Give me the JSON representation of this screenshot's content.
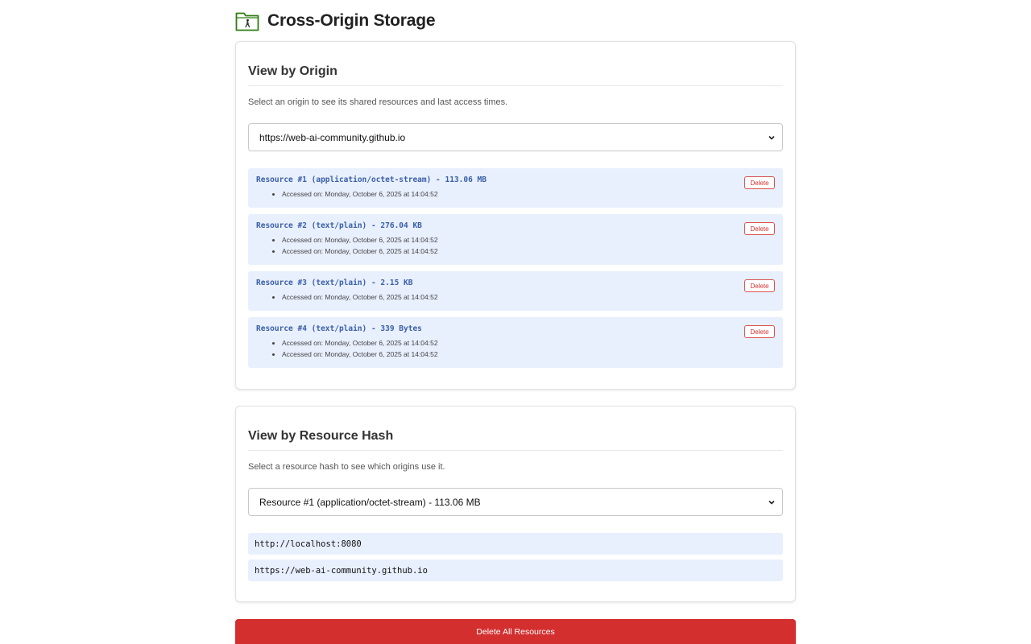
{
  "header": {
    "title": "Cross-Origin Storage",
    "icon": "folder-person-icon",
    "icon_color": "#2e7d12"
  },
  "by_origin": {
    "heading": "View by Origin",
    "description": "Select an origin to see its shared resources and last access times.",
    "selected_origin": "https://web-ai-community.github.io",
    "delete_label": "Delete",
    "resources": [
      {
        "title": "Resource #1 (application/octet-stream) - 113.06 MB",
        "accesses": [
          "Accessed on: Monday, October 6, 2025 at 14:04:52"
        ]
      },
      {
        "title": "Resource #2 (text/plain) - 276.04 KB",
        "accesses": [
          "Accessed on: Monday, October 6, 2025 at 14:04:52",
          "Accessed on: Monday, October 6, 2025 at 14:04:52"
        ]
      },
      {
        "title": "Resource #3 (text/plain) - 2.15 KB",
        "accesses": [
          "Accessed on: Monday, October 6, 2025 at 14:04:52"
        ]
      },
      {
        "title": "Resource #4 (text/plain) - 339 Bytes",
        "accesses": [
          "Accessed on: Monday, October 6, 2025 at 14:04:52",
          "Accessed on: Monday, October 6, 2025 at 14:04:52"
        ]
      }
    ]
  },
  "by_hash": {
    "heading": "View by Resource Hash",
    "description": "Select a resource hash to see which origins use it.",
    "selected_resource": "Resource #1 (application/octet-stream) - 113.06 MB",
    "origins": [
      "http://localhost:8080",
      "https://web-ai-community.github.io"
    ]
  },
  "delete_all_label": "Delete All Resources",
  "colors": {
    "accent_blue": "#3a60a8",
    "row_bg": "#e8effd",
    "danger": "#d32f2f"
  }
}
